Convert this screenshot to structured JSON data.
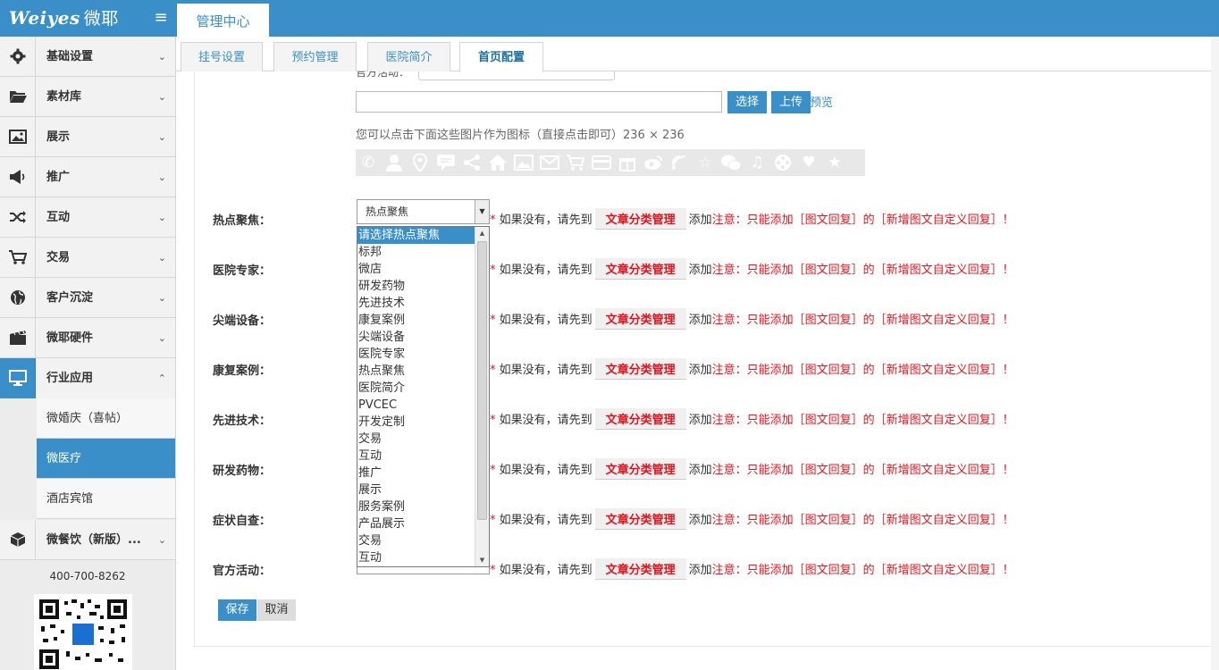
{
  "header": {
    "logo_text": "Weiyes",
    "logo_cn": "微耶",
    "menu_icon": "menu-icon",
    "main_tab": "管理中心"
  },
  "sidebar": {
    "items": [
      {
        "label": "基础设置",
        "icon": "gear-icon"
      },
      {
        "label": "素材库",
        "icon": "folder-icon"
      },
      {
        "label": "展示",
        "icon": "image-icon"
      },
      {
        "label": "推广",
        "icon": "megaphone-icon"
      },
      {
        "label": "互动",
        "icon": "shuffle-icon"
      },
      {
        "label": "交易",
        "icon": "cart-icon"
      },
      {
        "label": "客户沉淀",
        "icon": "globe-icon"
      },
      {
        "label": "微耶硬件",
        "icon": "film-icon"
      },
      {
        "label": "行业应用",
        "icon": "monitor-icon"
      }
    ],
    "sub_items": [
      "微婚庆（喜帖）",
      "微医疗",
      "酒店宾馆"
    ],
    "last_item": {
      "label": "微餐饮（新版）...",
      "icon": "cube-icon"
    },
    "phone": "400-700-8262"
  },
  "subtabs": [
    "挂号设置",
    "预约管理",
    "医院简介",
    "首页配置"
  ],
  "form": {
    "cut_label": "官方活动：",
    "cut_value": "官方活动",
    "choose_btn": "选择",
    "upload_btn": "上传",
    "preview_link": "预览",
    "icon_hint": "您可以点击下面这些图片作为图标（直接点击即可）236 × 236",
    "rows": [
      {
        "label": "热点聚焦：",
        "value": "热点聚焦"
      },
      {
        "label": "医院专家：",
        "value": ""
      },
      {
        "label": "尖端设备：",
        "value": ""
      },
      {
        "label": "康复案例：",
        "value": ""
      },
      {
        "label": "先进技术：",
        "value": ""
      },
      {
        "label": "研发药物：",
        "value": ""
      },
      {
        "label": "症状自查：",
        "value": ""
      },
      {
        "label": "官方活动：",
        "value": ""
      }
    ],
    "note_star": "*",
    "note_prefix": " 如果没有，请先到",
    "note_manage": "文章分类管理",
    "note_add": "添加",
    "note_warn": "注意：只能添加［图文回复］的［新增图文自定义回复］！",
    "save": "保存",
    "cancel": "取消"
  },
  "dropdown_options": [
    "请选择热点聚焦",
    "标邦",
    "微店",
    "研发药物",
    "先进技术",
    "康复案例",
    "尖端设备",
    "医院专家",
    "热点聚焦",
    "医院简介",
    "PVCEC",
    "开发定制",
    "交易",
    "互动",
    "推广",
    "展示",
    "服务案例",
    "产品展示",
    "交易",
    "互动"
  ],
  "colors": {
    "accent": "#3a8fc8",
    "warn": "#e0141e"
  }
}
